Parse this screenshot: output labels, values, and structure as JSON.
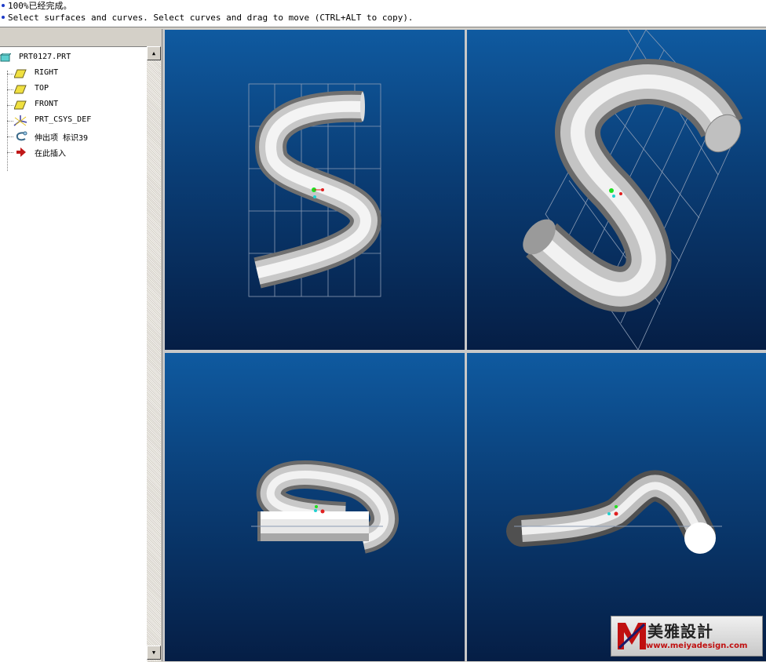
{
  "messages": [
    "100%已经完成。",
    "Select surfaces and curves.  Select curves and drag to move (CTRL+ALT to copy)."
  ],
  "model_tree": {
    "items": [
      {
        "label": "PRT0127.PRT",
        "icon": "part-icon"
      },
      {
        "label": "RIGHT",
        "icon": "datum-plane-icon"
      },
      {
        "label": "TOP",
        "icon": "datum-plane-icon"
      },
      {
        "label": "FRONT",
        "icon": "datum-plane-icon"
      },
      {
        "label": "PRT_CSYS_DEF",
        "icon": "coordinate-system-icon"
      },
      {
        "label": "伸出项 标识39",
        "icon": "protrusion-icon"
      },
      {
        "label": "在此插入",
        "icon": "insert-here-arrow-icon"
      }
    ]
  },
  "colors": {
    "viewport_top": "#0f5aa0",
    "viewport_bottom": "#051e45",
    "tube": "#e6e6e6",
    "datum_plane": "#f0e040",
    "insert_arrow": "#c01818"
  },
  "watermark": {
    "name": "美雅設計",
    "url": "www.meiyadesign.com"
  }
}
